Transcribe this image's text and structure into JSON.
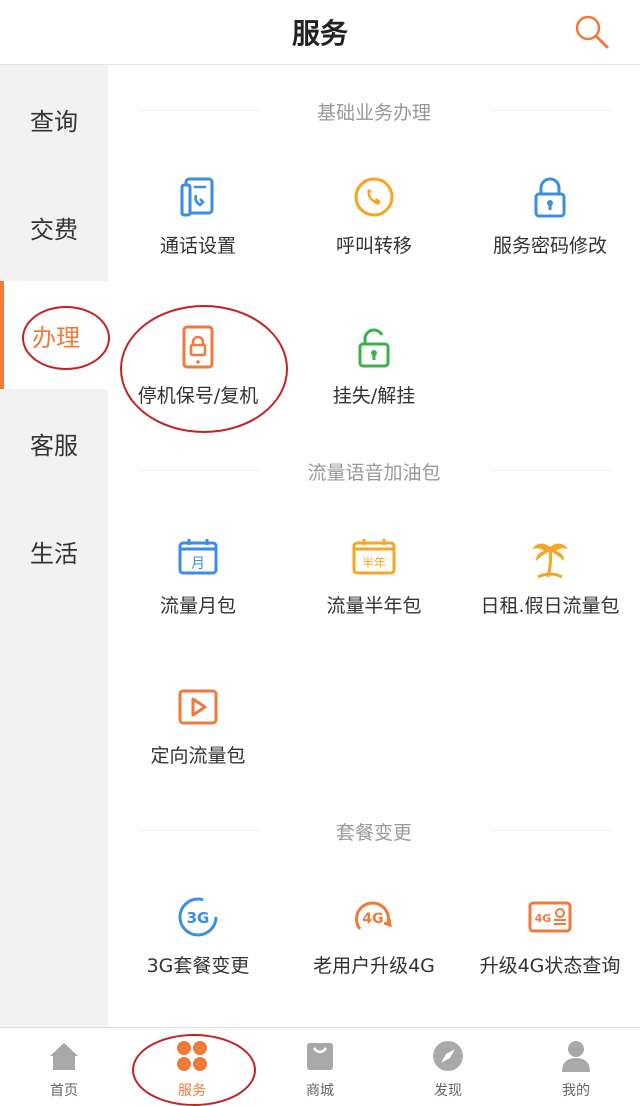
{
  "header": {
    "title": "服务",
    "search_icon": "search-icon"
  },
  "sidebar": {
    "items": [
      {
        "label": "查询"
      },
      {
        "label": "交费"
      },
      {
        "label": "办理",
        "active": true
      },
      {
        "label": "客服"
      },
      {
        "label": "生活"
      }
    ]
  },
  "sections": {
    "basic": {
      "title": "基础业务办理",
      "items": [
        {
          "label": "通话设置",
          "icon": "phone-book-icon"
        },
        {
          "label": "呼叫转移",
          "icon": "call-forward-icon"
        },
        {
          "label": "服务密码修改",
          "icon": "lock-icon"
        },
        {
          "label": "停机保号/复机",
          "icon": "phone-lock-icon"
        },
        {
          "label": "挂失/解挂",
          "icon": "unlock-icon"
        }
      ]
    },
    "data": {
      "title": "流量语音加油包",
      "items": [
        {
          "label": "流量月包",
          "icon": "calendar-month-icon",
          "badge": "月"
        },
        {
          "label": "流量半年包",
          "icon": "calendar-halfyear-icon",
          "badge": "半年"
        },
        {
          "label": "日租.假日流量包",
          "icon": "palm-tree-icon"
        },
        {
          "label": "定向流量包",
          "icon": "play-icon"
        }
      ]
    },
    "plan": {
      "title": "套餐变更",
      "items": [
        {
          "label": "3G套餐变更",
          "icon": "3g-icon",
          "badge": "3G"
        },
        {
          "label": "老用户升级4G",
          "icon": "4g-upgrade-icon",
          "badge": "4G"
        },
        {
          "label": "升级4G状态查询",
          "icon": "4g-query-icon",
          "badge": "4G"
        }
      ]
    }
  },
  "tabbar": {
    "items": [
      {
        "label": "首页",
        "icon": "home-icon"
      },
      {
        "label": "服务",
        "icon": "grid-icon",
        "active": true
      },
      {
        "label": "商城",
        "icon": "shopping-bag-icon"
      },
      {
        "label": "发现",
        "icon": "compass-icon"
      },
      {
        "label": "我的",
        "icon": "person-icon"
      }
    ]
  },
  "colors": {
    "accent": "#f07a3a",
    "blue": "#3a8ee6",
    "green": "#3cb34a",
    "yellow": "#f5a623",
    "annotation": "#c62020"
  }
}
